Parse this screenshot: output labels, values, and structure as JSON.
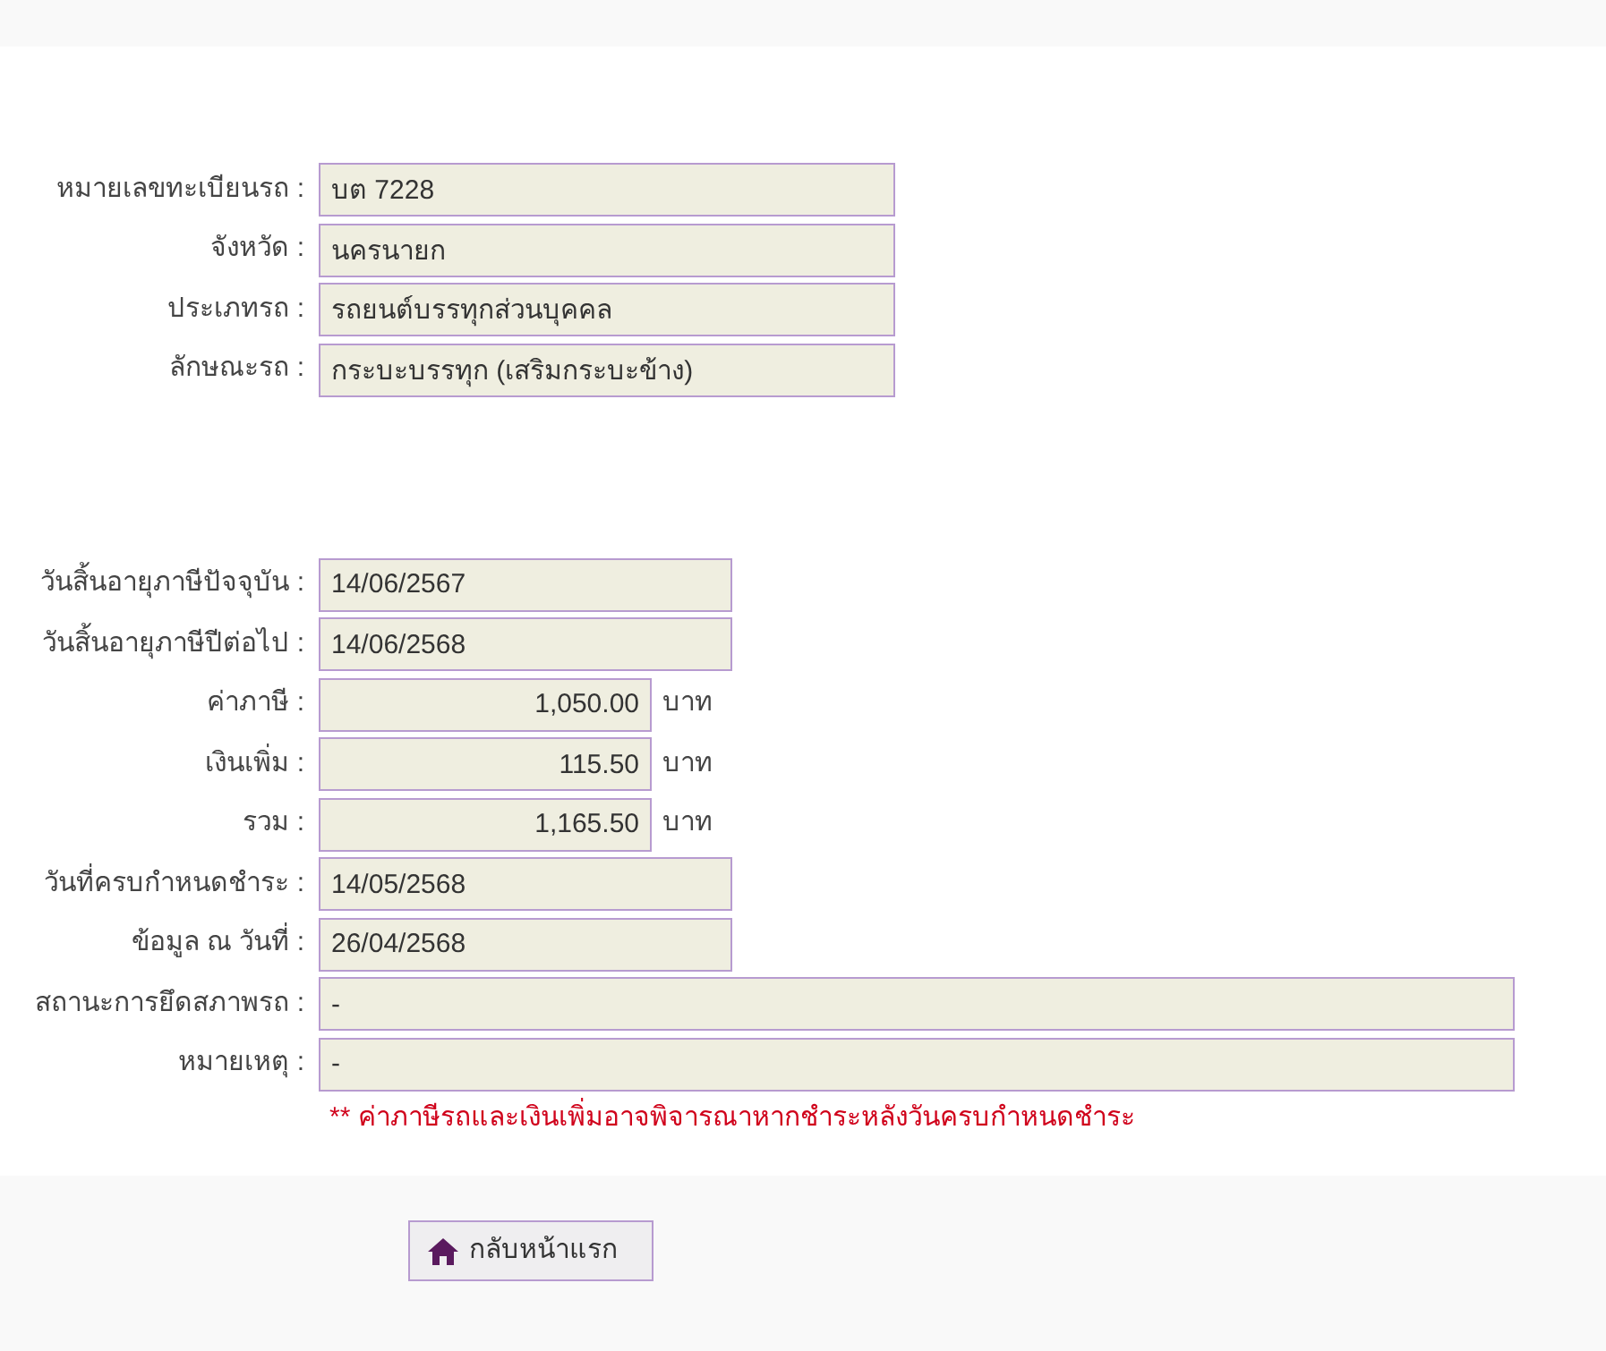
{
  "vehicle": [
    {
      "label": "หมายเลขทะเบียนรถ :",
      "value": "บต 7228"
    },
    {
      "label": "จังหวัด :",
      "value": "นครนายก"
    },
    {
      "label": "ประเภทรถ :",
      "value": "รถยนต์บรรทุกส่วนบุคคล"
    },
    {
      "label": "ลักษณะรถ :",
      "value": "กระบะบรรทุก (เสริมกระบะข้าง)"
    }
  ],
  "tax": [
    {
      "kind": "date",
      "label": "วันสิ้นอายุภาษีปัจจุบัน :",
      "value": "14/06/2567"
    },
    {
      "kind": "date",
      "label": "วันสิ้นอายุภาษีปีต่อไป :",
      "value": "14/06/2568"
    },
    {
      "kind": "money",
      "label": "ค่าภาษี :",
      "value": "1,050.00",
      "unit": "บาท"
    },
    {
      "kind": "money",
      "label": "เงินเพิ่ม :",
      "value": "115.50",
      "unit": "บาท"
    },
    {
      "kind": "money",
      "label": "รวม :",
      "value": "1,165.50",
      "unit": "บาท"
    },
    {
      "kind": "date",
      "label": "วันที่ครบกำหนดชำระ :",
      "value": "14/05/2568"
    },
    {
      "kind": "date",
      "label": "ข้อมูล ณ วันที่ :",
      "value": "26/04/2568"
    },
    {
      "kind": "wide",
      "label": "สถานะการยึดสภาพรถ :",
      "value": "-"
    },
    {
      "kind": "wide",
      "label": "หมายเหตุ :",
      "value": "-"
    }
  ],
  "note": "** ค่าภาษีรถและเงินเพิ่มอาจพิจารณาหากชำระหลังวันครบกำหนดชำระ",
  "home_button": "กลับหน้าแรก"
}
